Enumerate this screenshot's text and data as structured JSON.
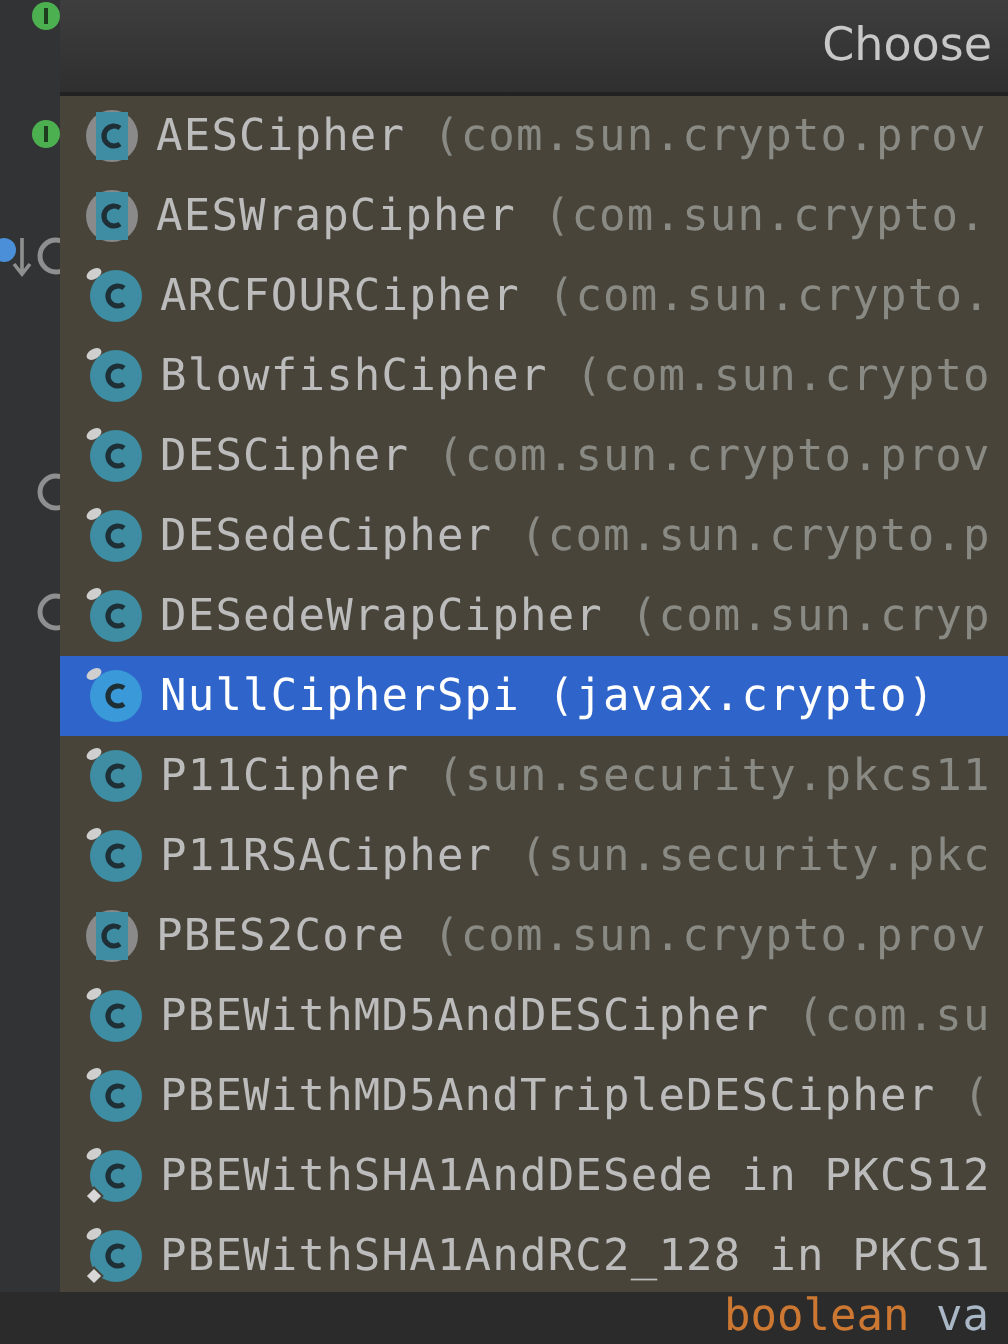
{
  "popup": {
    "title": "Choose",
    "items": [
      {
        "name": "AESCipher",
        "location": "(com.sun.crypto.prov",
        "kind": "abstract",
        "selected": false
      },
      {
        "name": "AESWrapCipher",
        "location": "(com.sun.crypto.",
        "kind": "abstract",
        "selected": false
      },
      {
        "name": "ARCFOURCipher",
        "location": "(com.sun.crypto.",
        "kind": "class",
        "selected": false
      },
      {
        "name": "BlowfishCipher",
        "location": "(com.sun.crypto",
        "kind": "class",
        "selected": false
      },
      {
        "name": "DESCipher",
        "location": "(com.sun.crypto.prov",
        "kind": "class",
        "selected": false
      },
      {
        "name": "DESedeCipher",
        "location": "(com.sun.crypto.p",
        "kind": "class",
        "selected": false
      },
      {
        "name": "DESedeWrapCipher",
        "location": "(com.sun.cryp",
        "kind": "class",
        "selected": false
      },
      {
        "name": "NullCipherSpi",
        "location": "(javax.crypto)",
        "kind": "class",
        "selected": true
      },
      {
        "name": "P11Cipher",
        "location": "(sun.security.pkcs11",
        "kind": "class",
        "selected": false
      },
      {
        "name": "P11RSACipher",
        "location": "(sun.security.pkc",
        "kind": "class",
        "selected": false
      },
      {
        "name": "PBES2Core",
        "location": "(com.sun.crypto.prov",
        "kind": "abstract",
        "selected": false
      },
      {
        "name": "PBEWithMD5AndDESCipher",
        "location": "(com.su",
        "kind": "class",
        "selected": false
      },
      {
        "name": "PBEWithMD5AndTripleDESCipher",
        "location": "(",
        "kind": "class",
        "selected": false
      },
      {
        "name": "PBEWithSHA1AndDESede in PKCS12",
        "kind": "class-diamond",
        "selected": false
      },
      {
        "name": "PBEWithSHA1AndRC2_128 in PKCS1",
        "kind": "class-diamond",
        "selected": false
      }
    ]
  },
  "code_line": [
    {
      "text": "boolean",
      "kind": "keyword"
    },
    {
      "text": "va",
      "kind": "identifier"
    }
  ]
}
